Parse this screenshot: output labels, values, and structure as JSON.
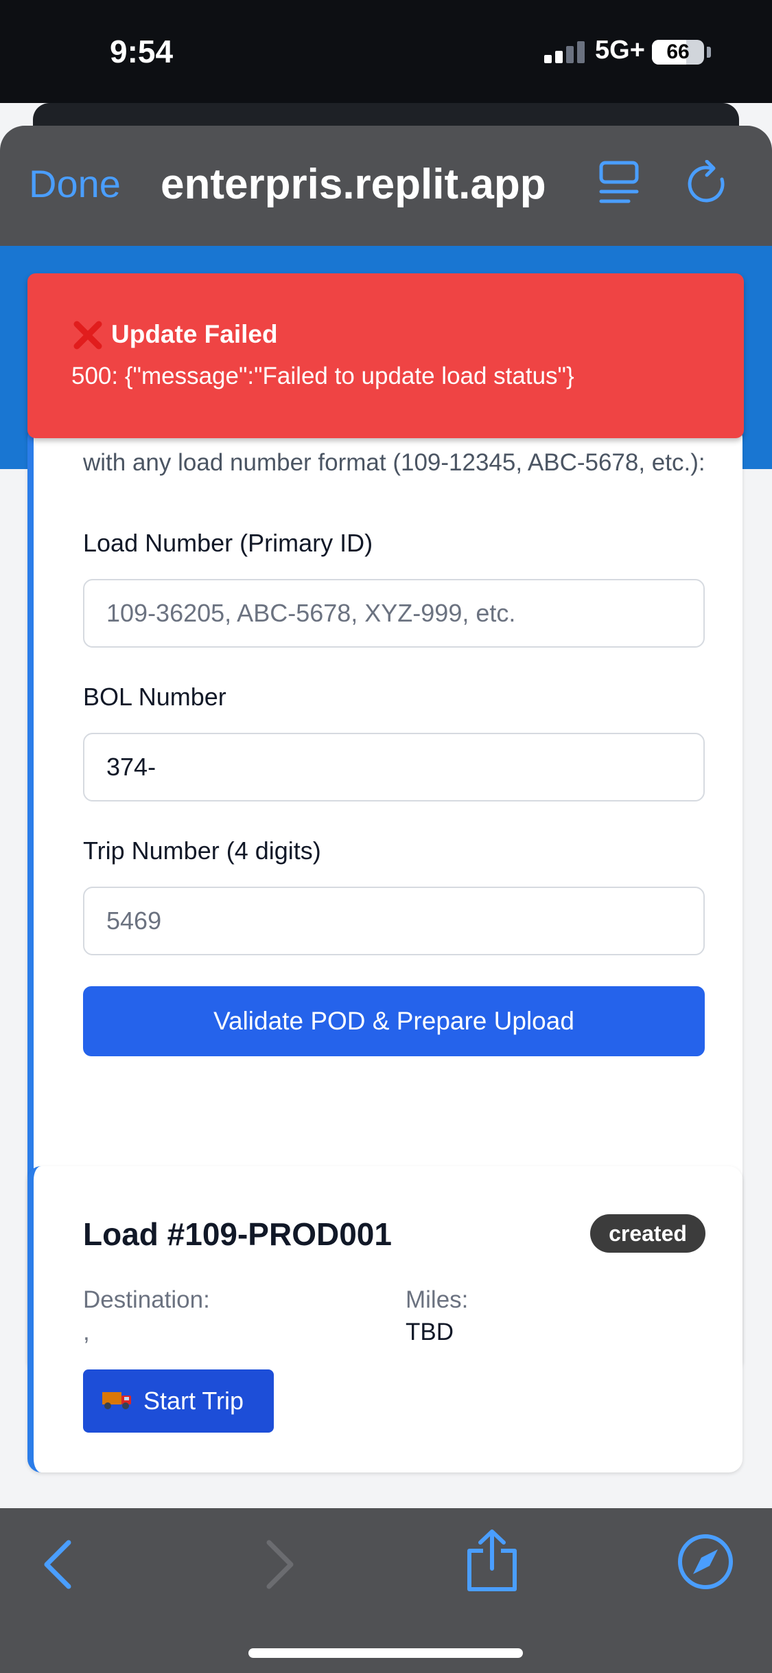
{
  "status_bar": {
    "time": "9:54",
    "network": "5G+",
    "battery": "66",
    "battery_level": 0.66
  },
  "browser": {
    "done_label": "Done",
    "url": "enterpris.replit.app"
  },
  "toast": {
    "title": "Update Failed",
    "message": "500: {\"message\":\"Failed to update load status\"}"
  },
  "pod_form": {
    "intro": "with any load number format (109-12345, ABC-5678, etc.):",
    "load_number_label": "Load Number (Primary ID)",
    "load_number_placeholder": "109-36205, ABC-5678, XYZ-999, etc.",
    "bol_label": "BOL Number",
    "bol_value": "374-",
    "trip_label": "Trip Number (4 digits)",
    "trip_placeholder": "5469",
    "submit_label": "Validate POD & Prepare Upload"
  },
  "load_card": {
    "title": "Load #109-PROD001",
    "status": "created",
    "destination_label": "Destination:",
    "destination_value": ",",
    "miles_label": "Miles:",
    "miles_value": "TBD",
    "start_label": "Start Trip"
  },
  "colors": {
    "accent": "#2563eb",
    "toast": "#ef4444",
    "banner": "#1976d2",
    "ios_blue": "#4a9eff"
  },
  "icons": [
    "close-x-icon",
    "truck-icon",
    "reader-icon",
    "reload-icon",
    "back-icon",
    "forward-icon",
    "share-icon",
    "compass-icon",
    "signal-icon",
    "battery-icon"
  ]
}
